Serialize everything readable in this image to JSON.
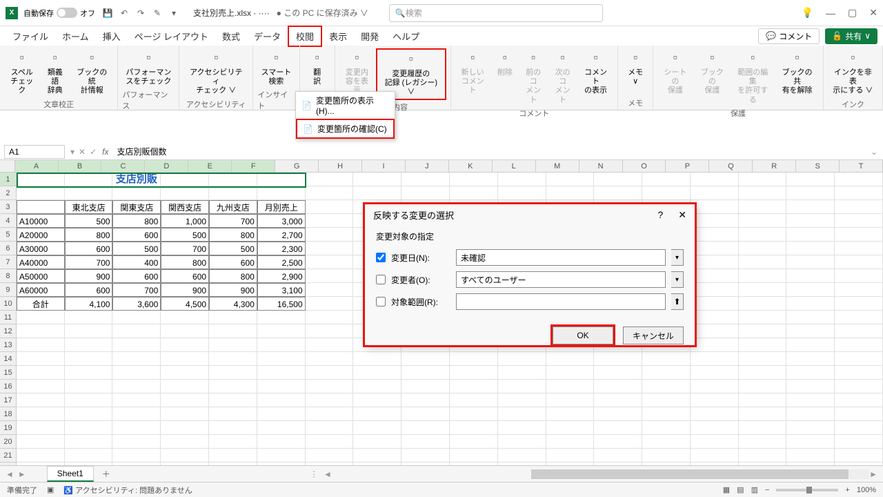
{
  "titlebar": {
    "autosave_label": "自動保存",
    "autosave_state": "オフ",
    "filename": "支社別売上.xlsx · ····",
    "saved": "● この PC に保存済み ∨",
    "search_placeholder": "検索"
  },
  "tabs": [
    "ファイル",
    "ホーム",
    "挿入",
    "ページ レイアウト",
    "数式",
    "データ",
    "校閲",
    "表示",
    "開発",
    "ヘルプ"
  ],
  "tab_active": "校閲",
  "comments_btn": "コメント",
  "share_btn": "共有",
  "ribbon": {
    "groups": [
      {
        "label": "文章校正",
        "items": [
          {
            "t": "スペル\nチェック"
          },
          {
            "t": "類義語\n辞典"
          },
          {
            "t": "ブックの統\n計情報"
          }
        ]
      },
      {
        "label": "パフォーマンス",
        "items": [
          {
            "t": "パフォーマン\nスをチェック"
          }
        ]
      },
      {
        "label": "アクセシビリティ",
        "items": [
          {
            "t": "アクセシビリティ\nチェック ∨"
          }
        ]
      },
      {
        "label": "インサイト",
        "items": [
          {
            "t": "スマート\n検索"
          }
        ]
      },
      {
        "label": "言語",
        "items": [
          {
            "t": "翻\n訳"
          }
        ]
      },
      {
        "label": "変更内容",
        "items": [
          {
            "t": "変更内\n容を表示",
            "d": true
          },
          {
            "t": "変更履歴の\n記録 (レガシー) ∨",
            "h": true
          }
        ]
      },
      {
        "label": "コメント",
        "items": [
          {
            "t": "新しい\nコメント",
            "d": true
          },
          {
            "t": "削除",
            "d": true
          },
          {
            "t": "前のコ\nメント",
            "d": true
          },
          {
            "t": "次のコ\nメント",
            "d": true
          },
          {
            "t": "コメント\nの表示"
          }
        ]
      },
      {
        "label": "メモ",
        "items": [
          {
            "t": "メモ\n∨"
          }
        ]
      },
      {
        "label": "保護",
        "items": [
          {
            "t": "シートの\n保護",
            "d": true
          },
          {
            "t": "ブックの\n保護",
            "d": true
          },
          {
            "t": "範囲の編集\nを許可する",
            "d": true
          },
          {
            "t": "ブックの共\n有を解除"
          }
        ]
      },
      {
        "label": "インク",
        "items": [
          {
            "t": "インクを非表\n示にする ∨"
          }
        ]
      }
    ]
  },
  "dropdown": [
    {
      "t": "変更箇所の表示(H)..."
    },
    {
      "t": "変更箇所の確認(C)",
      "h": true
    }
  ],
  "namebox": "A1",
  "formula": "支店別販個数",
  "cols": [
    "A",
    "B",
    "C",
    "D",
    "E",
    "F",
    "G",
    "H",
    "I",
    "J",
    "K",
    "L",
    "M",
    "N",
    "O",
    "P",
    "Q",
    "R",
    "S",
    "T"
  ],
  "sheet": {
    "title": "支店別販個数",
    "headers": [
      "",
      "東北支店",
      "関東支店",
      "関西支店",
      "九州支店",
      "月別売上"
    ],
    "rows": [
      [
        "A10000",
        "500",
        "800",
        "1,000",
        "700",
        "3,000"
      ],
      [
        "A20000",
        "800",
        "600",
        "500",
        "800",
        "2,700"
      ],
      [
        "A30000",
        "600",
        "500",
        "700",
        "500",
        "2,300"
      ],
      [
        "A40000",
        "700",
        "400",
        "800",
        "600",
        "2,500"
      ],
      [
        "A50000",
        "900",
        "600",
        "600",
        "800",
        "2,900"
      ],
      [
        "A60000",
        "600",
        "700",
        "900",
        "900",
        "3,100"
      ]
    ],
    "total": [
      "合計",
      "4,100",
      "3,600",
      "4,500",
      "4,300",
      "16,500"
    ]
  },
  "dialog": {
    "title": "反映する変更の選択",
    "section": "変更対象の指定",
    "row1_label": "変更日(N):",
    "row1_value": "未確認",
    "row2_label": "変更者(O):",
    "row2_value": "すべてのユーザー",
    "row3_label": "対象範囲(R):",
    "ok": "OK",
    "cancel": "キャンセル"
  },
  "sheet_tab": "Sheet1",
  "status": {
    "ready": "準備完了",
    "acc": "アクセシビリティ: 問題ありません",
    "zoom": "100%"
  }
}
